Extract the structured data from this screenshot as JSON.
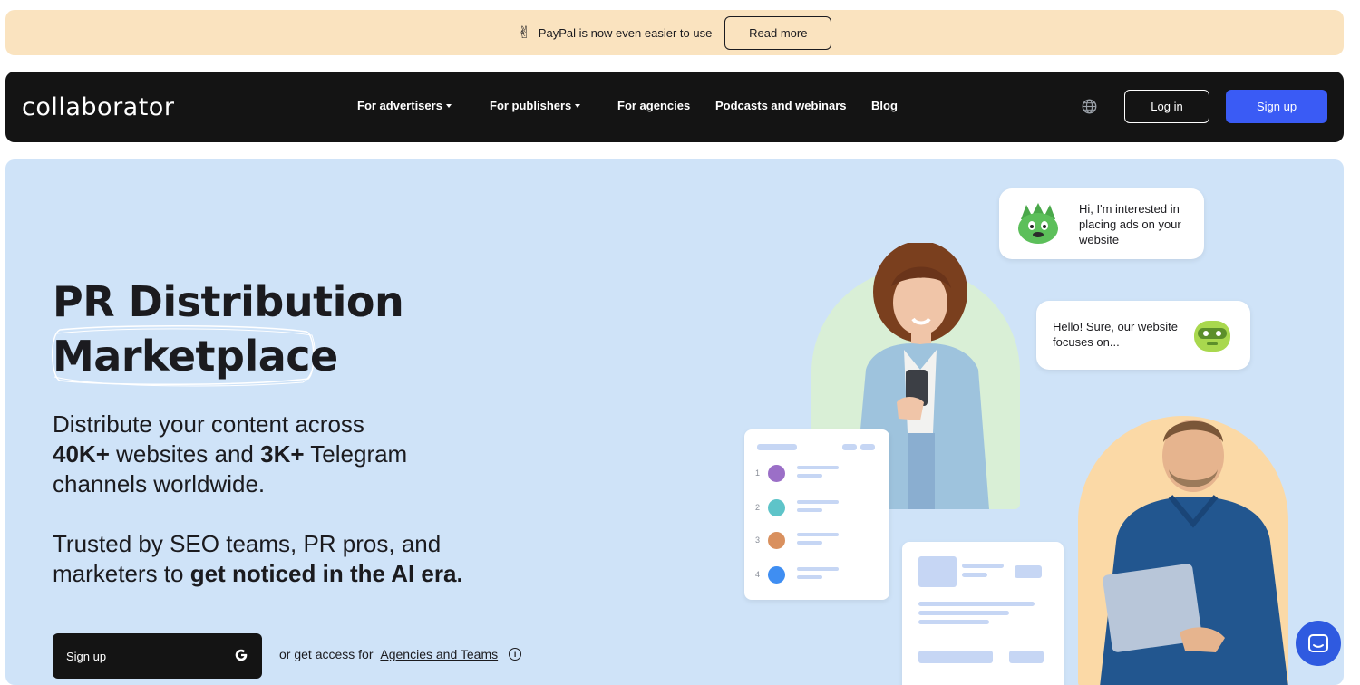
{
  "announcement": {
    "emoji": "✌",
    "message": "PayPal is now even easier to use",
    "button": "Read more"
  },
  "nav": {
    "logo": "collaborator",
    "links": [
      {
        "label": "For advertisers",
        "dropdown": true
      },
      {
        "label": "For publishers",
        "dropdown": true
      },
      {
        "label": "For agencies",
        "dropdown": false
      },
      {
        "label": "Podcasts and webinars",
        "dropdown": false
      },
      {
        "label": "Blog",
        "dropdown": false
      }
    ],
    "login": "Log in",
    "signup": "Sign up"
  },
  "hero": {
    "title_line1": "PR Distribution",
    "title_line2": "Marketplace",
    "sub_a": "Distribute your content across",
    "sub_b1": "40K+",
    "sub_b2": " websites and ",
    "sub_b3": "3K+",
    "sub_b4": " Telegram",
    "sub_c": "channels worldwide.",
    "trust_a": "Trusted by SEO teams, PR pros, and",
    "trust_b": "marketers to ",
    "trust_bold": "get noticed in the AI era.",
    "cta": "Sign up",
    "alt_text": "or get access for ",
    "alt_link": "Agencies and Teams",
    "bubble1": "Hi, I'm interested in placing ads on your website",
    "bubble2": "Hello! Sure, our website focuses on...",
    "ranks": [
      "1",
      "2",
      "3",
      "4"
    ],
    "rank_colors": [
      "#9b6fc7",
      "#5ec4c9",
      "#d9905e",
      "#3f8ef2"
    ]
  },
  "colors": {
    "accent": "#3a5bf5",
    "hero_bg": "#cfe3f8",
    "announce_bg": "#fae3bf",
    "nav_bg": "#141414"
  }
}
